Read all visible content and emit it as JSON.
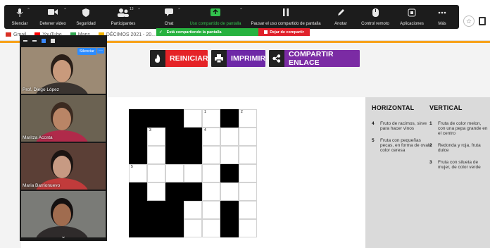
{
  "zoom_toolbar": {
    "items": [
      {
        "label": "Silenciar",
        "icon": "microphone-icon"
      },
      {
        "label": "Detener video",
        "icon": "video-camera-icon"
      },
      {
        "label": "Seguridad",
        "icon": "shield-icon"
      },
      {
        "label": "Participantes",
        "icon": "participants-icon",
        "count": "13"
      },
      {
        "label": "Chat",
        "icon": "chat-icon"
      },
      {
        "label": "Uso compartido de pantalla",
        "icon": "share-screen-icon"
      },
      {
        "label": "Pausar el uso compartido de pantalla",
        "icon": "pause-icon"
      },
      {
        "label": "Anotar",
        "icon": "pen-icon"
      },
      {
        "label": "Control remoto",
        "icon": "mouse-icon"
      },
      {
        "label": "Aplicaciones",
        "icon": "apps-icon"
      },
      {
        "label": "Más",
        "icon": "more-icon"
      }
    ],
    "sharing_status": "Está compartiendo la pantalla",
    "stop_share": "Dejar de compartir"
  },
  "bookmarks": [
    "Gmail",
    "YouTube",
    "Maps",
    "DÉCIMOS 2021 - 20..."
  ],
  "actions": {
    "restart": "REINICIAR",
    "print": "IMPRIMIR",
    "share_link": "COMPARTIR ENLACE"
  },
  "crossword": {
    "rows": [
      "###..#.",
      "#.##...",
      "#.##...",
      ".....#.",
      "#.##...",
      "###..#.",
      "###..#."
    ],
    "numbers": [
      {
        "r": 0,
        "c": 4,
        "n": "1"
      },
      {
        "r": 0,
        "c": 6,
        "n": "2"
      },
      {
        "r": 1,
        "c": 1,
        "n": "3"
      },
      {
        "r": 1,
        "c": 4,
        "n": "4"
      },
      {
        "r": 3,
        "c": 0,
        "n": "5"
      }
    ]
  },
  "clues": {
    "horizontal_title": "HORIZONTAL",
    "vertical_title": "VERTICAL",
    "horizontal": [
      {
        "num": "4",
        "text": "Fruto de racimos, sirve para hacer vinos"
      },
      {
        "num": "5",
        "text": "Fruta con pequeñas pecas, en forma de ovalo color ceresa"
      }
    ],
    "vertical": [
      {
        "num": "1",
        "text": "Fruta de color melon, con una pepa grande en el centro"
      },
      {
        "num": "2",
        "text": "Redonda y roja, fruta dulce"
      },
      {
        "num": "3",
        "text": "Fruta con silueta de mujer, de color verde"
      }
    ]
  },
  "participants": [
    {
      "name": "Prof. Diego López",
      "bg": "#9c8a74",
      "shirt": "#3a3430",
      "skin": "#c99a7c",
      "hair": "#2a1f18"
    },
    {
      "name": "Maritza Acosta",
      "bg": "#6b6252",
      "shirt": "#b02a4a",
      "skin": "#b98566",
      "hair": "#3b2a20"
    },
    {
      "name": "Maria Barrionuevo",
      "bg": "#5b3f36",
      "shirt": "#c13b3b",
      "skin": "#c79a83",
      "hair": "#1b1412"
    },
    {
      "name": "",
      "bg": "#7a7b77",
      "shirt": "#2f2b2b",
      "skin": "#a06c4f",
      "hair": "#141010"
    }
  ],
  "video_panel": {
    "mute_button": "Silenciar",
    "more_button": "···"
  }
}
